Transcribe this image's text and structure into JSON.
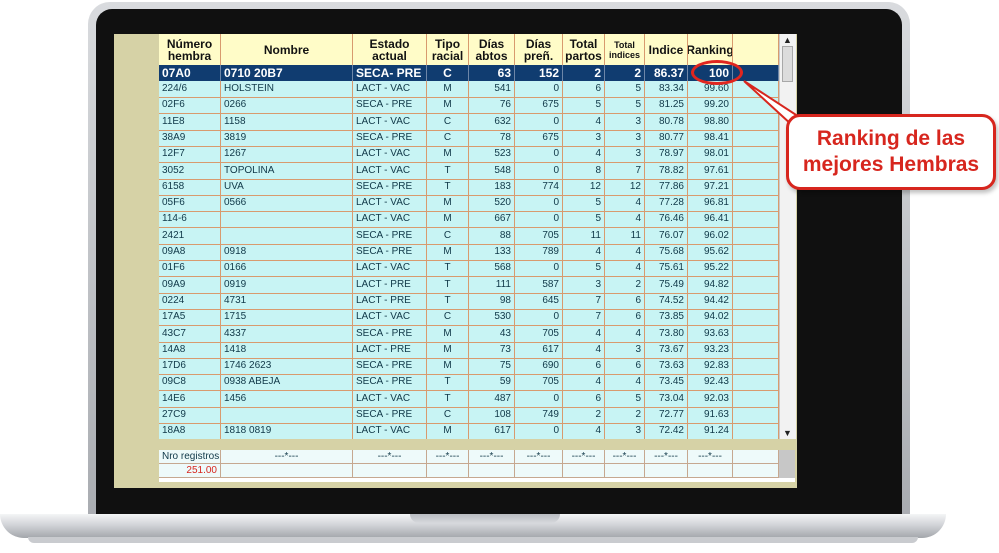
{
  "headers": [
    {
      "label": "Número hembra"
    },
    {
      "label": "Nombre"
    },
    {
      "label": "Estado actual"
    },
    {
      "label": "Tipo racial"
    },
    {
      "label": "Días abtos"
    },
    {
      "label": "Días preñ."
    },
    {
      "label": "Total partos"
    },
    {
      "label": "Total indices"
    },
    {
      "label": "Indice"
    },
    {
      "label": "Ranking"
    }
  ],
  "selected_row": [
    "07A0",
    "0710  20B7",
    "SECA- PRE",
    "C",
    "63",
    "152",
    "2",
    "2",
    "86.37",
    "100"
  ],
  "rows": [
    [
      "224/6",
      "HOLSTEIN",
      "LACT - VAC",
      "M",
      "541",
      "0",
      "6",
      "5",
      "83.34",
      "99.60"
    ],
    [
      "02F6",
      "0266",
      "SECA - PRE",
      "M",
      "76",
      "675",
      "5",
      "5",
      "81.25",
      "99.20"
    ],
    [
      "11E8",
      "1158",
      "LACT - VAC",
      "C",
      "632",
      "0",
      "4",
      "3",
      "80.78",
      "98.80"
    ],
    [
      "38A9",
      "3819",
      "SECA - PRE",
      "C",
      "78",
      "675",
      "3",
      "3",
      "80.77",
      "98.41"
    ],
    [
      "12F7",
      "1267",
      "LACT - VAC",
      "M",
      "523",
      "0",
      "4",
      "3",
      "78.97",
      "98.01"
    ],
    [
      "3052",
      "TOPOLINA",
      "LACT - VAC",
      "T",
      "548",
      "0",
      "8",
      "7",
      "78.82",
      "97.61"
    ],
    [
      "6158",
      "UVA",
      "SECA - PRE",
      "T",
      "183",
      "774",
      "12",
      "12",
      "77.86",
      "97.21"
    ],
    [
      "05F6",
      "0566",
      "LACT - VAC",
      "M",
      "520",
      "0",
      "5",
      "4",
      "77.28",
      "96.81"
    ],
    [
      "114-6",
      "",
      "LACT - VAC",
      "M",
      "667",
      "0",
      "5",
      "4",
      "76.46",
      "96.41"
    ],
    [
      "2421",
      "",
      "SECA - PRE",
      "C",
      "88",
      "705",
      "11",
      "11",
      "76.07",
      "96.02"
    ],
    [
      "09A8",
      "0918",
      "SECA - PRE",
      "M",
      "133",
      "789",
      "4",
      "4",
      "75.68",
      "95.62"
    ],
    [
      "01F6",
      "0166",
      "LACT - VAC",
      "T",
      "568",
      "0",
      "5",
      "4",
      "75.61",
      "95.22"
    ],
    [
      "09A9",
      "0919",
      "LACT - PRE",
      "T",
      "111",
      "587",
      "3",
      "2",
      "75.49",
      "94.82"
    ],
    [
      "0224",
      "4731",
      "LACT - PRE",
      "T",
      "98",
      "645",
      "7",
      "6",
      "74.52",
      "94.42"
    ],
    [
      "17A5",
      "1715",
      "LACT - VAC",
      "C",
      "530",
      "0",
      "7",
      "6",
      "73.85",
      "94.02"
    ],
    [
      "43C7",
      "4337",
      "SECA - PRE",
      "M",
      "43",
      "705",
      "4",
      "4",
      "73.80",
      "93.63"
    ],
    [
      "14A8",
      "1418",
      "LACT - PRE",
      "M",
      "73",
      "617",
      "4",
      "3",
      "73.67",
      "93.23"
    ],
    [
      "17D6",
      "1746  2623",
      "SECA - PRE",
      "M",
      "75",
      "690",
      "6",
      "6",
      "73.63",
      "92.83"
    ],
    [
      "09C8",
      "0938 ABEJA",
      "SECA - PRE",
      "T",
      "59",
      "705",
      "4",
      "4",
      "73.45",
      "92.43"
    ],
    [
      "14E6",
      "1456",
      "LACT - VAC",
      "T",
      "487",
      "0",
      "6",
      "5",
      "73.04",
      "92.03"
    ],
    [
      "27C9",
      "",
      "SECA - PRE",
      "C",
      "108",
      "749",
      "2",
      "2",
      "72.77",
      "91.63"
    ],
    [
      "18A8",
      "1818  0819",
      "LACT - VAC",
      "M",
      "617",
      "0",
      "4",
      "3",
      "72.42",
      "91.24"
    ]
  ],
  "footer": {
    "label": "Nro registros",
    "count": "251.00",
    "placeholder": "---*---"
  },
  "scroll": {
    "up": "▲",
    "down": "▼"
  },
  "callout": {
    "line1": "Ranking de las",
    "line2": "mejores Hembras"
  },
  "colors": {
    "accent_red": "#d7261e",
    "selected_row_bg": "#103c70",
    "row_bg": "#c8f4f4",
    "header_bg": "#fffcc8"
  }
}
